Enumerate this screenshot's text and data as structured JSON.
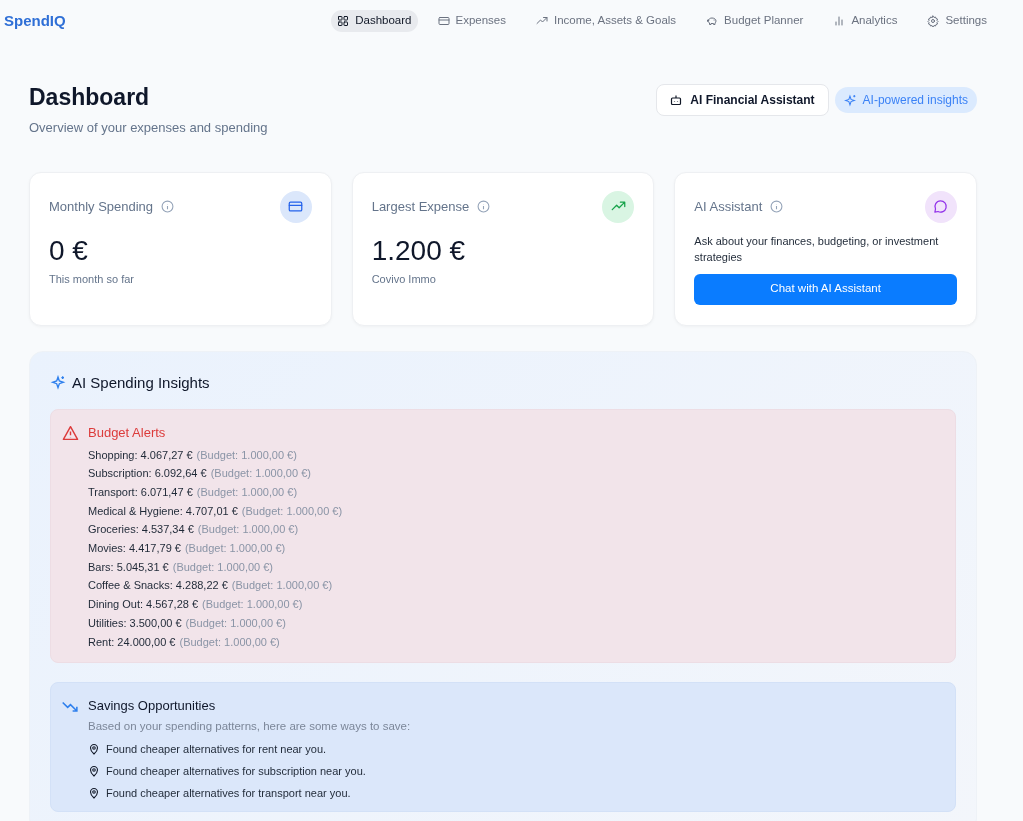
{
  "brand": "SpendIQ",
  "nav": [
    {
      "label": "Dashboard",
      "selected": true
    },
    {
      "label": "Expenses",
      "selected": false
    },
    {
      "label": "Income, Assets & Goals",
      "selected": false
    },
    {
      "label": "Budget Planner",
      "selected": false
    },
    {
      "label": "Analytics",
      "selected": false
    },
    {
      "label": "Settings",
      "selected": false
    }
  ],
  "header": {
    "title": "Dashboard",
    "subtitle": "Overview of your expenses and spending",
    "assistant_button": "AI Financial Assistant",
    "badge": "AI-powered insights"
  },
  "cards": [
    {
      "kind": "stat",
      "title": "Monthly Spending",
      "value": "0 €",
      "caption": "This month so far"
    },
    {
      "kind": "stat",
      "title": "Largest Expense",
      "value": "1.200 €",
      "caption": "Covivo Immo"
    },
    {
      "kind": "assistant",
      "title": "AI Assistant",
      "text": "Ask about your finances, budgeting, or investment strategies",
      "button": "Chat with AI Assistant"
    }
  ],
  "insights": {
    "title": "AI Spending Insights",
    "alerts": {
      "title": "Budget Alerts",
      "items": [
        {
          "spent": "Shopping: 4.067,27 €",
          "budget": "(Budget: 1.000,00 €)"
        },
        {
          "spent": "Subscription: 6.092,64 €",
          "budget": "(Budget: 1.000,00 €)"
        },
        {
          "spent": "Transport: 6.071,47 €",
          "budget": "(Budget: 1.000,00 €)"
        },
        {
          "spent": "Medical & Hygiene: 4.707,01 €",
          "budget": "(Budget: 1.000,00 €)"
        },
        {
          "spent": "Groceries: 4.537,34 €",
          "budget": "(Budget: 1.000,00 €)"
        },
        {
          "spent": "Movies: 4.417,79 €",
          "budget": "(Budget: 1.000,00 €)"
        },
        {
          "spent": "Bars: 5.045,31 €",
          "budget": "(Budget: 1.000,00 €)"
        },
        {
          "spent": "Coffee & Snacks: 4.288,22 €",
          "budget": "(Budget: 1.000,00 €)"
        },
        {
          "spent": "Dining Out: 4.567,28 €",
          "budget": "(Budget: 1.000,00 €)"
        },
        {
          "spent": "Utilities: 3.500,00 €",
          "budget": "(Budget: 1.000,00 €)"
        },
        {
          "spent": "Rent: 24.000,00 €",
          "budget": "(Budget: 1.000,00 €)"
        }
      ]
    },
    "savings": {
      "title": "Savings Opportunities",
      "intro": "Based on your spending patterns, here are some ways to save:",
      "items": [
        "Found cheaper alternatives for rent near you.",
        "Found cheaper alternatives for subscription near you.",
        "Found cheaper alternatives for transport near you."
      ]
    }
  }
}
